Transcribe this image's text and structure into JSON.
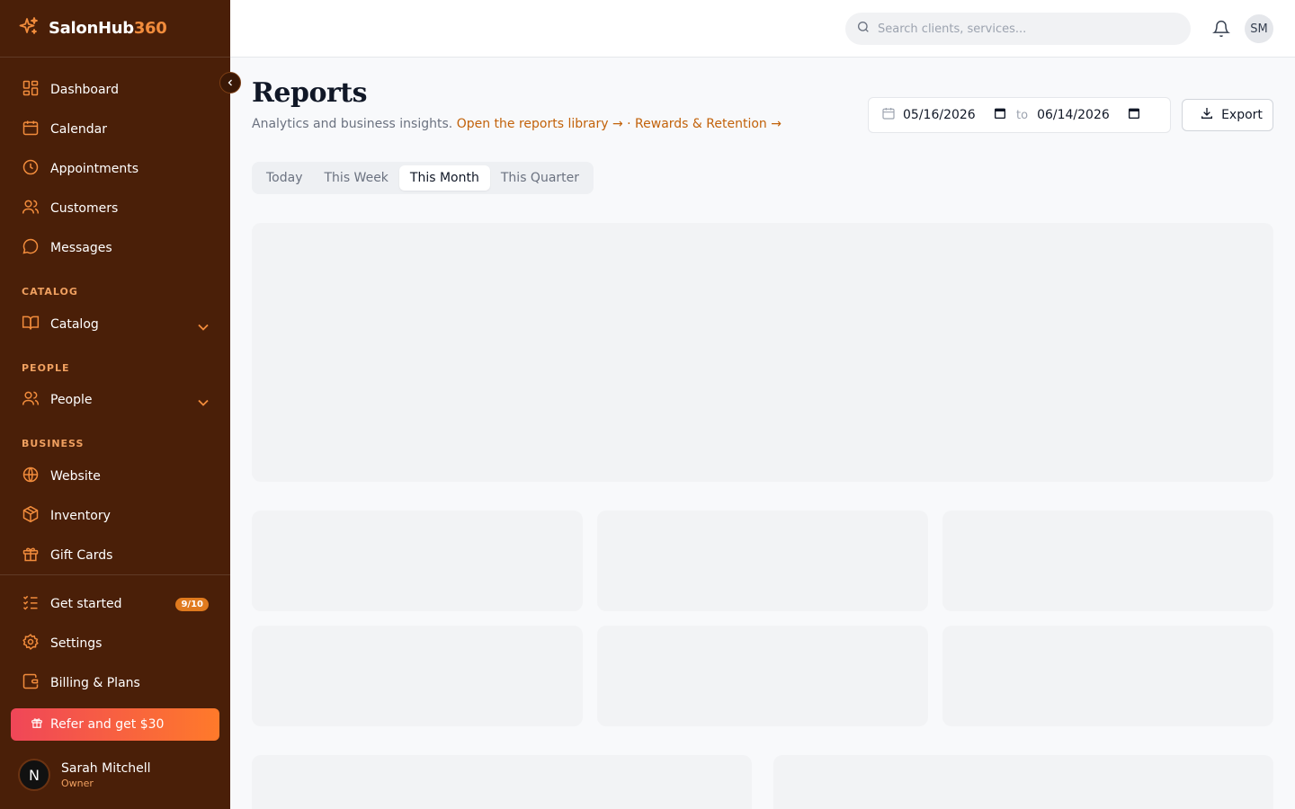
{
  "brand": {
    "name_main": "SalonHub",
    "name_accent": "360"
  },
  "sidebar": {
    "main_items": [
      {
        "label": "Dashboard",
        "icon": "dashboard-icon"
      },
      {
        "label": "Calendar",
        "icon": "calendar-icon"
      },
      {
        "label": "Appointments",
        "icon": "clock-icon"
      },
      {
        "label": "Customers",
        "icon": "users-icon"
      },
      {
        "label": "Messages",
        "icon": "message-icon"
      }
    ],
    "catalog_section": "CATALOG",
    "catalog_item": "Catalog",
    "people_section": "PEOPLE",
    "people_item": "People",
    "business_section": "BUSINESS",
    "business_items": [
      {
        "label": "Website",
        "icon": "globe-icon"
      },
      {
        "label": "Inventory",
        "icon": "box-icon"
      },
      {
        "label": "Gift Cards",
        "icon": "gift-icon"
      }
    ],
    "bottom_items": [
      {
        "label": "Get started",
        "badge": "9/10",
        "icon": "checklist-icon"
      },
      {
        "label": "Settings",
        "icon": "gear-icon"
      },
      {
        "label": "Billing & Plans",
        "icon": "wallet-icon"
      }
    ],
    "refer_label": "Refer and get $30",
    "user": {
      "initial": "N",
      "name": "Sarah Mitchell",
      "role": "Owner"
    }
  },
  "topbar": {
    "search_placeholder": "Search clients, services...",
    "avatar_initials": "SM"
  },
  "page": {
    "title": "Reports",
    "subtitle": "Analytics and business insights.",
    "link_library": "Open the reports library →",
    "separator": "·",
    "link_rewards": "Rewards & Retention →",
    "date_from": "05/16/2026",
    "date_to": "06/14/2026",
    "to_label": "to",
    "export_label": "Export",
    "tabs": [
      "Today",
      "This Week",
      "This Month",
      "This Quarter"
    ],
    "active_tab": "This Month"
  },
  "colors": {
    "sidebar_bg": "#4a1f08",
    "accent": "#f28c3c",
    "link": "#c2620a",
    "refer_gradient_start": "#f04658",
    "refer_gradient_end": "#ff7a2a"
  }
}
